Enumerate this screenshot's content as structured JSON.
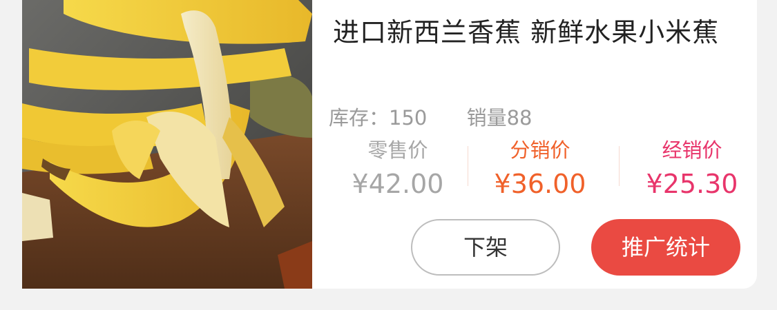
{
  "product": {
    "image_alt": "banana-photo",
    "title": "进口新西兰香蕉  新鲜水果小米蕉",
    "stock_label": "库存：150",
    "sales_label": "销量88"
  },
  "prices": {
    "retail": {
      "label": "零售价",
      "value": "¥42.00"
    },
    "distribution": {
      "label": "分销价",
      "value": "¥36.00"
    },
    "dealer": {
      "label": "经销价",
      "value": "¥25.30"
    }
  },
  "actions": {
    "delist_label": "下架",
    "promo_stats_label": "推广统计"
  },
  "colors": {
    "distribution_price": "#f0612a",
    "dealer_price": "#e8356b",
    "promo_button": "#ea4a42"
  }
}
